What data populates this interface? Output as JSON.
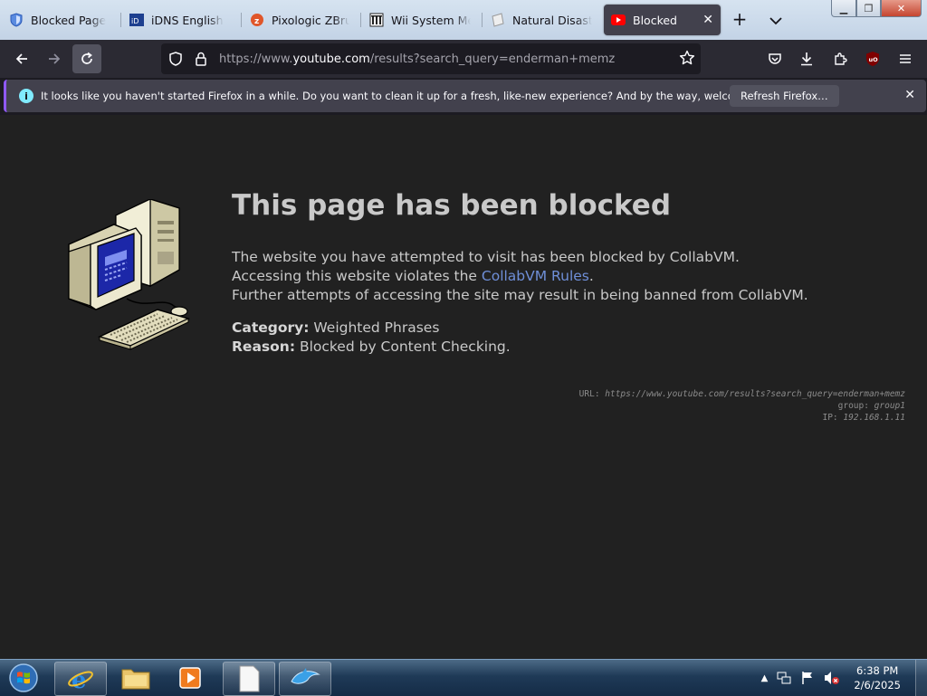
{
  "browser": {
    "tabs": [
      {
        "title": "Blocked Page",
        "icon": "shield-icon"
      },
      {
        "title": "iDNS English",
        "icon": "idns-favicon"
      },
      {
        "title": "Pixologic ZBrush",
        "icon": "zbrush-favicon"
      },
      {
        "title": "Wii System Menu",
        "icon": "wiki-favicon"
      },
      {
        "title": "Natural Disasters",
        "icon": "page-favicon"
      },
      {
        "title": "Blocked",
        "icon": "youtube-favicon",
        "active": true
      }
    ],
    "url": {
      "prefix": "https://www.",
      "domain": "youtube.com",
      "path": "/results?search_query=enderman+memz"
    },
    "notification": {
      "message": "It looks like you haven't started Firefox in a while. Do you want to clean it up for a fresh, like-new experience? And by the way, welcome back!",
      "button": "Refresh Firefox…"
    }
  },
  "page": {
    "heading": "This page has been blocked",
    "desc": {
      "line1": "The website you have attempted to visit has been blocked by CollabVM.",
      "line2_pre": "Accessing this website violates the ",
      "line2_link": "CollabVM Rules",
      "line2_post": ".",
      "line3": "Further attempts of accessing the site may result in being banned from CollabVM."
    },
    "category_label": "Category:",
    "category_value": " Weighted Phrases",
    "reason_label": "Reason:",
    "reason_value": " Blocked by Content Checking.",
    "debug": {
      "url_label": "URL: ",
      "url_value": "https://www.youtube.com/results?search_query=enderman+memz",
      "group_label": "group: ",
      "group_value": "group1",
      "ip_label": "IP: ",
      "ip_value": "192.168.1.11"
    }
  },
  "taskbar": {
    "items": [
      "internet-explorer",
      "file-explorer",
      "media-player",
      "blank-document",
      "dolphin-emulator"
    ],
    "time": "6:38 PM",
    "date": "2/6/2025"
  },
  "colors": {
    "page_bg": "#212121",
    "link": "#6f8fd8",
    "accent": "#9059ff"
  }
}
